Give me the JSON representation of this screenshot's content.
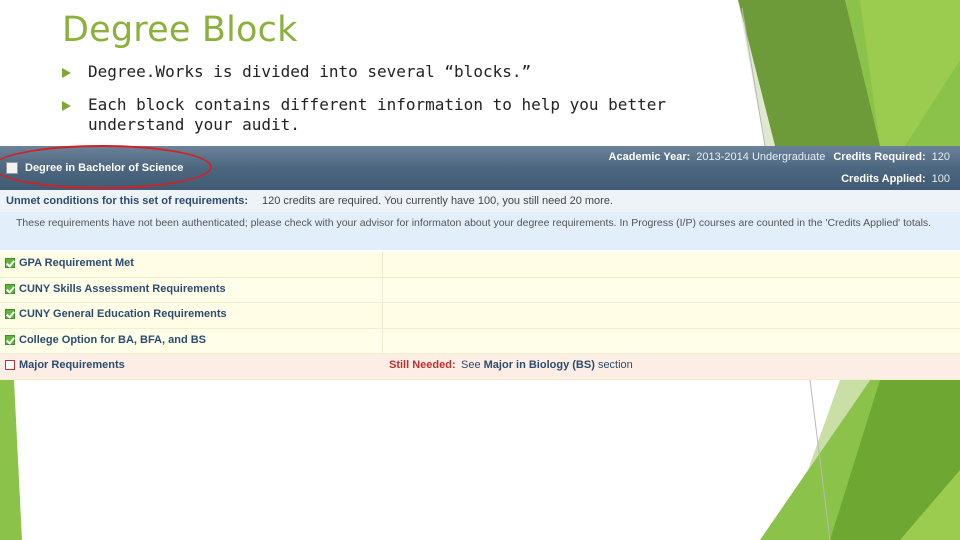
{
  "slide": {
    "title": "Degree Block",
    "bullets": [
      "Degree.Works is divided into several “blocks.”",
      "Each block contains different information to help you better understand your audit."
    ]
  },
  "degree_block": {
    "header": {
      "title": "Degree in Bachelor of Science",
      "academic_year_label": "Academic Year:",
      "academic_year_value": "2013-2014 Undergraduate",
      "credits_required_label": "Credits Required:",
      "credits_required_value": "120",
      "credits_applied_label": "Credits Applied:",
      "credits_applied_value": "100"
    },
    "unmet_label": "Unmet conditions for this set of requirements:",
    "unmet_text": "120 credits are required. You currently have 100, you still need 20 more.",
    "note": "These requirements have not been authenticated; please check with your advisor for informaton about your degree requirements. In Progress (I/P) courses are counted in the 'Credits Applied' totals.",
    "requirements": [
      {
        "label": "GPA Requirement Met",
        "met": true
      },
      {
        "label": "CUNY Skills Assessment Requirements",
        "met": true
      },
      {
        "label": "CUNY General Education Requirements",
        "met": true
      },
      {
        "label": "College Option for BA, BFA, and BS",
        "met": true
      },
      {
        "label": "Major Requirements",
        "met": false
      }
    ],
    "still_needed_label": "Still Needed:",
    "see_prefix": "See",
    "see_link": "Major in Biology (BS)",
    "see_suffix": "section"
  },
  "colors": {
    "title_green": "#8bb13a",
    "header_blue": "#4d6780",
    "highlight_red": "#d42020"
  }
}
